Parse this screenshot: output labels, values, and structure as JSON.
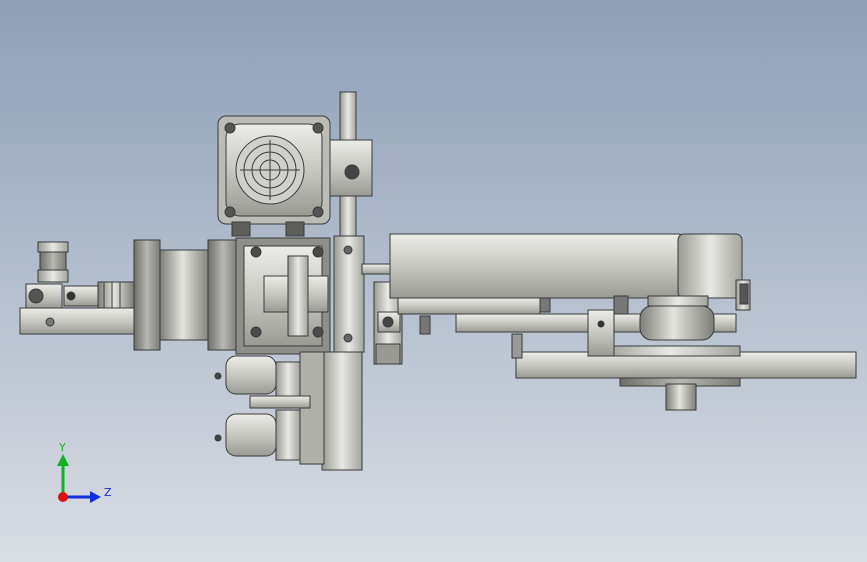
{
  "viewport": {
    "background_top": "#8e9fb6",
    "background_bottom": "#d9dde4"
  },
  "colors": {
    "metal_light": "#d4d4cf",
    "metal_mid": "#b6b6b0",
    "metal_dark": "#8a8a85",
    "edge": "#3a3a3a",
    "axis_x": "#e01010",
    "axis_y": "#10b020",
    "axis_z": "#1030e0"
  },
  "triad": {
    "y_label": "Y",
    "z_label": "Z"
  }
}
